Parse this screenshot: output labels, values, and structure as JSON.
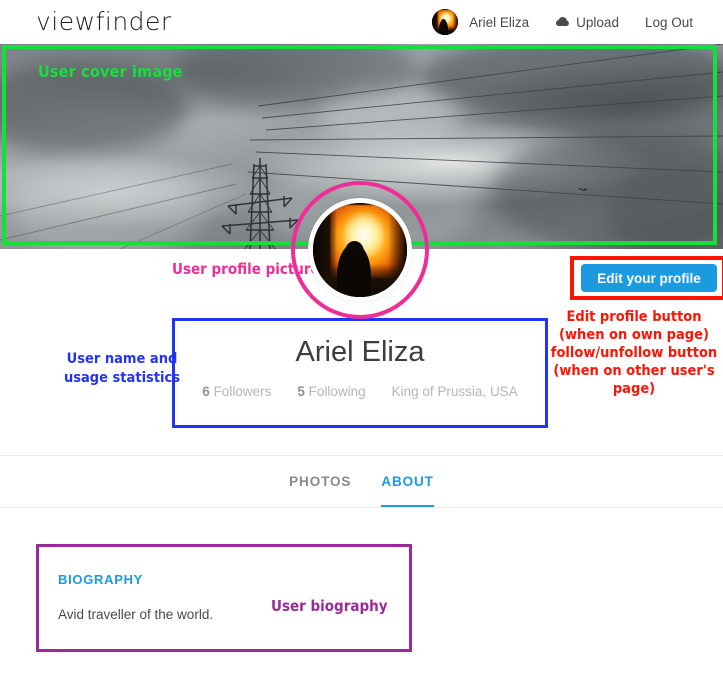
{
  "navbar": {
    "brand": "viewfinder",
    "avatar_icon": "user-avatar-bonfire",
    "user_name": "Ariel Eliza",
    "upload_label": "Upload",
    "upload_icon": "cloud-upload-icon",
    "logout_label": "Log Out"
  },
  "cover": {
    "description": "stormy grey sky with electricity pylon and power lines",
    "pylon_icon": "transmission-tower",
    "bird_icon": "bird-silhouette"
  },
  "profile": {
    "picture_icon": "profile-picture-bonfire",
    "name": "Ariel Eliza",
    "followers_count": "6",
    "followers_label": "Followers",
    "following_count": "5",
    "following_label": "Following",
    "location": "King of Prussia, USA",
    "edit_button_label": "Edit your profile"
  },
  "tabs": [
    {
      "label": "PHOTOS",
      "active": false
    },
    {
      "label": "ABOUT",
      "active": true
    }
  ],
  "biography": {
    "heading": "BIOGRAPHY",
    "text": "Avid traveller of the world."
  },
  "annotations": {
    "cover": {
      "text": "User cover image",
      "color": "#14e03c"
    },
    "profile_picture": {
      "text": "User profile picture",
      "color": "#ef2d96"
    },
    "edit_button": {
      "line1": "Edit profile button",
      "line2": "(when on own page)",
      "line3": "follow/unfollow button",
      "line4": "(when on other user's page)",
      "color": "#fc1505"
    },
    "identity": {
      "line1": "User name and",
      "line2": "usage statistics",
      "color": "#2234f0"
    },
    "biography": {
      "text": "User biography",
      "color": "#9a2a9a"
    }
  }
}
